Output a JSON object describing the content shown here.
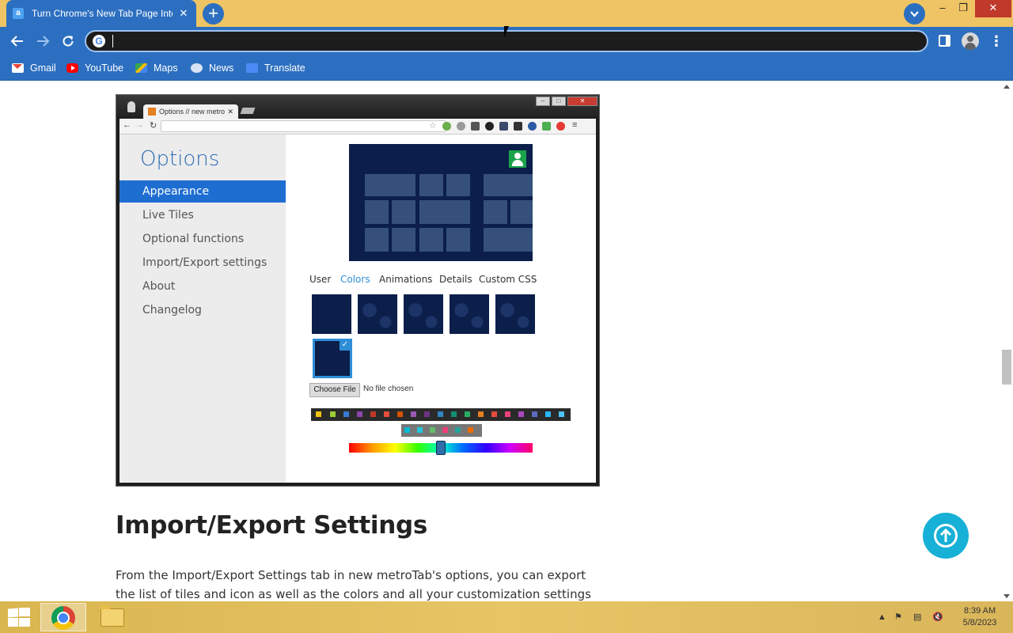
{
  "browser": {
    "tab": {
      "favicon": "a",
      "title": "Turn Chrome's New Tab Page Into",
      "close": "✕"
    },
    "new_tab": "+",
    "window_controls": {
      "minimize": "–",
      "maximize": "❐",
      "close": "✕"
    },
    "omnibox": {
      "value": "",
      "placeholder": ""
    },
    "toolbar_icons": [
      "back-icon",
      "forward-icon",
      "reload-icon",
      "google-icon",
      "side-panel-icon",
      "profile-icon",
      "menu-icon"
    ],
    "bookmarks": [
      {
        "label": "Gmail",
        "icon": "gmail-icon"
      },
      {
        "label": "YouTube",
        "icon": "youtube-icon"
      },
      {
        "label": "Maps",
        "icon": "maps-icon"
      },
      {
        "label": "News",
        "icon": "news-icon"
      },
      {
        "label": "Translate",
        "icon": "translate-icon"
      }
    ],
    "colors": {
      "tab_strip": "#eec464",
      "toolbar": "#2c6fc0",
      "accent": "#17b0d6"
    }
  },
  "screenshot": {
    "tab_title": "Options // new metro",
    "options_title": "Options",
    "menu": [
      {
        "label": "Appearance",
        "active": true
      },
      {
        "label": "Live Tiles",
        "active": false
      },
      {
        "label": "Optional functions",
        "active": false
      },
      {
        "label": "Import/Export settings",
        "active": false
      },
      {
        "label": "About",
        "active": false
      },
      {
        "label": "Changelog",
        "active": false
      }
    ],
    "subtabs": [
      {
        "label": "User",
        "active": false
      },
      {
        "label": "Colors",
        "active": true
      },
      {
        "label": "Animations",
        "active": false
      },
      {
        "label": "Details",
        "active": false
      },
      {
        "label": "Custom CSS",
        "active": false
      }
    ],
    "choose_file": "Choose File",
    "no_file": "No file chosen",
    "hue_slider_value": 0.5
  },
  "article": {
    "heading": "Import/Export Settings",
    "paragraph": "From the Import/Export Settings tab in new metroTab's options, you can export the list of tiles and icon as well as the colors and all your customization settings for the"
  },
  "taskbar": {
    "time": "8:39 AM",
    "date": "5/8/2023",
    "tray_icons": [
      "show-hidden-icon",
      "action-center-flag-icon",
      "network-icon",
      "volume-muted-icon"
    ]
  }
}
